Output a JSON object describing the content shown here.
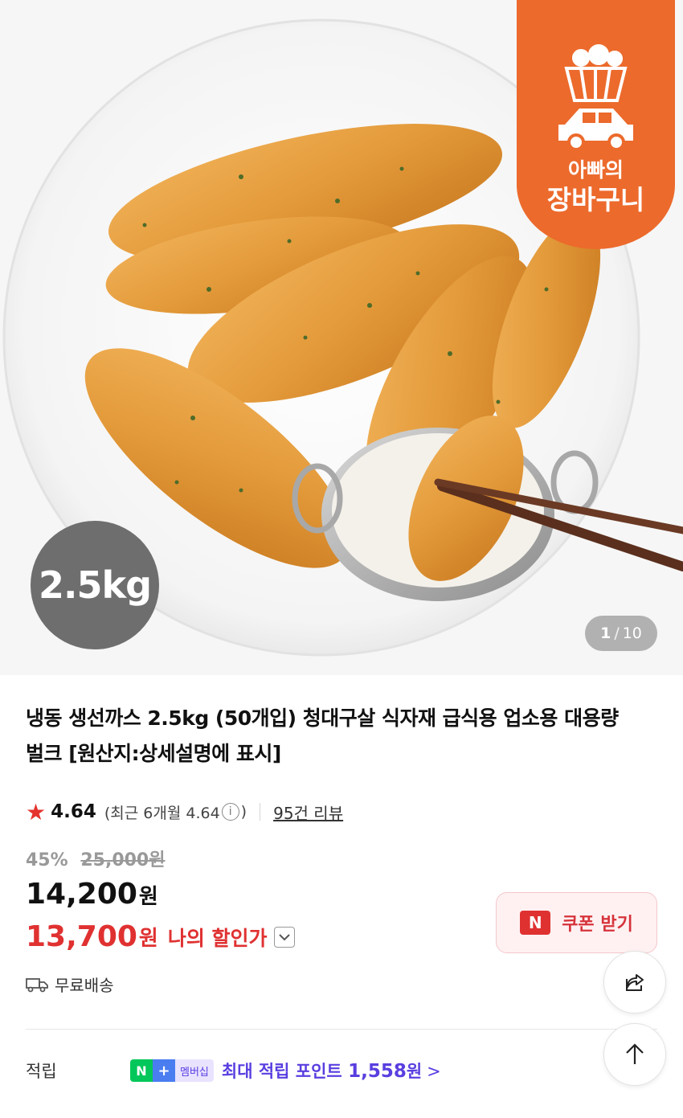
{
  "hero": {
    "brand_line1": "아빠의",
    "brand_line2": "장바구니",
    "weight_badge": "2.5kg",
    "pager_current": "1",
    "pager_separator": "/",
    "pager_total": "10"
  },
  "product": {
    "title": "냉동 생선까스 2.5kg (50개입) 청대구살 식자재 급식용 업소용 대용량 벌크 [원산지:상세설명에 표시]",
    "star_icon": "★",
    "rating": "4.64",
    "recent_rating_open": "(최근 6개월 4.64",
    "info_icon": "i",
    "recent_rating_close": ")",
    "review_count": "95건 리뷰",
    "discount_percent": "45%",
    "original_price": "25,000원",
    "price_value": "14,200",
    "price_unit": "원",
    "my_price_value": "13,700",
    "my_price_unit": "원",
    "my_price_label": "나의 할인가",
    "coupon_logo": "N",
    "coupon_label": "쿠폰 받기",
    "shipping_label": "무료배송",
    "points_label": "적립",
    "membership_n": "N",
    "membership_plus": "+",
    "membership_text": "멤버십",
    "points_prefix": "최대 적립 포인트 ",
    "points_value": "1,558",
    "points_unit": "원",
    "points_chevron": ">"
  },
  "colors": {
    "brand_orange": "#ec6a2c",
    "discount_red": "#e03131",
    "points_purple": "#5a3ee0",
    "naver_green": "#03c75a"
  },
  "icons": [
    "star-icon",
    "info-icon",
    "chevron-down-icon",
    "truck-icon",
    "share-icon",
    "arrow-up-icon",
    "basket-icon",
    "car-icon"
  ]
}
